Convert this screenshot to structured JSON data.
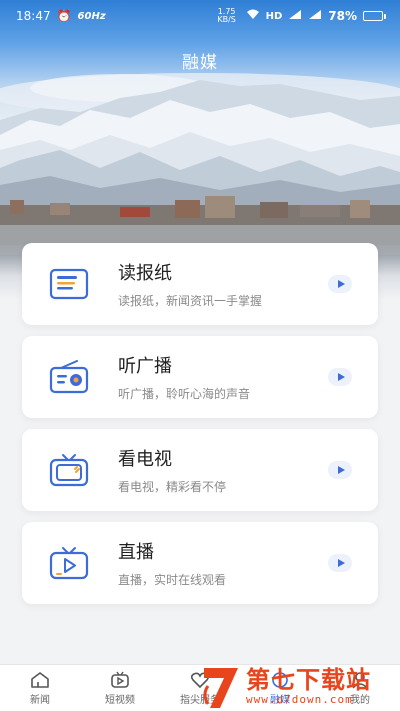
{
  "status_bar": {
    "time": "18:47",
    "refresh_rate": "60Hz",
    "speed": "1.75 KB/S",
    "network": "HD",
    "battery": "78%",
    "battery_level": 0.78
  },
  "header": {
    "title": "融媒"
  },
  "cards": [
    {
      "title": "读报纸",
      "subtitle": "读报纸，新闻资讯一手掌握",
      "icon": "newspaper-icon"
    },
    {
      "title": "听广播",
      "subtitle": "听广播，聆听心海的声音",
      "icon": "radio-icon"
    },
    {
      "title": "看电视",
      "subtitle": "看电视，精彩看不停",
      "icon": "tv-icon"
    },
    {
      "title": "直播",
      "subtitle": "直播，实时在线观看",
      "icon": "live-icon"
    }
  ],
  "tabbar": {
    "tabs": [
      {
        "label": "新闻",
        "icon": "home-icon"
      },
      {
        "label": "短视频",
        "icon": "video-icon"
      },
      {
        "label": "指尖服务",
        "icon": "heart-icon"
      },
      {
        "label": "融媒",
        "icon": "media-icon"
      },
      {
        "label": "我的",
        "icon": "profile-icon"
      }
    ]
  },
  "watermark": {
    "name": "第七下载站",
    "url": "www.d7down.com"
  },
  "colors": {
    "accent": "#3d6cd8",
    "icon_orange": "#f0a33a",
    "watermark": "#e8451c"
  }
}
